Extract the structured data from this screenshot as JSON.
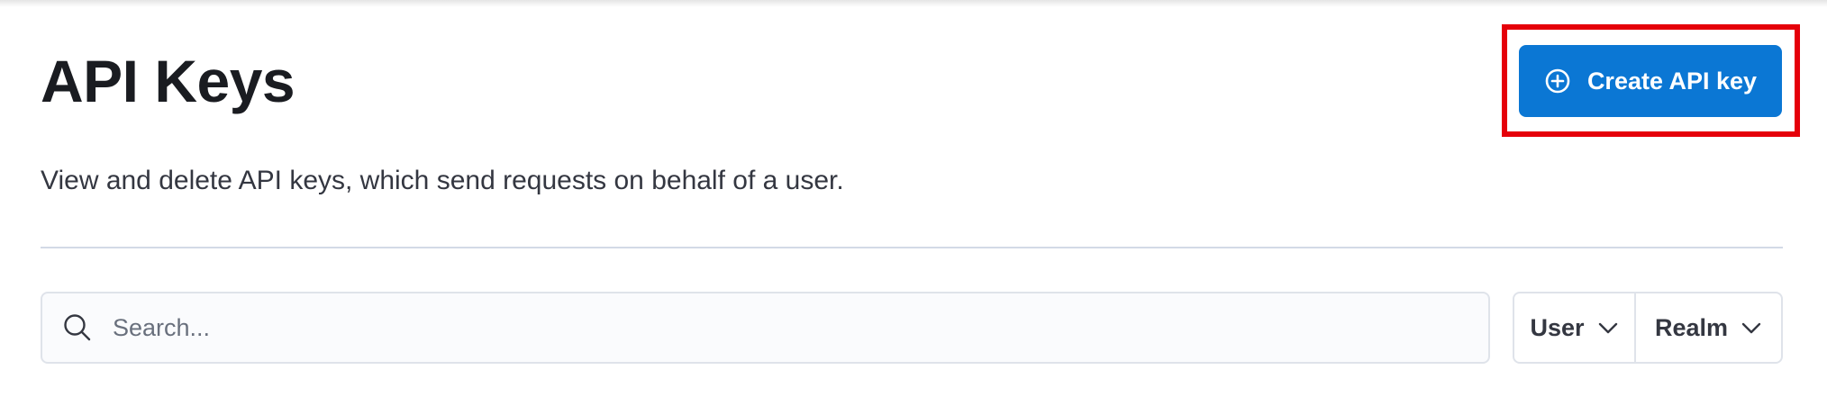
{
  "header": {
    "title": "API Keys",
    "create_button_label": "Create API key",
    "create_button_icon": "plus-in-circle-icon",
    "description": "View and delete API keys, which send requests on behalf of a user."
  },
  "toolbar": {
    "search": {
      "placeholder": "Search...",
      "value": "",
      "icon": "search-icon"
    },
    "filters": [
      {
        "label": "User",
        "icon": "chevron-down-icon"
      },
      {
        "label": "Realm",
        "icon": "chevron-down-icon"
      }
    ]
  },
  "colors": {
    "primary_button": "#0b77d4",
    "highlight_box": "#e5000a",
    "divider": "#d3dae6",
    "title_text": "#1a1c21"
  }
}
